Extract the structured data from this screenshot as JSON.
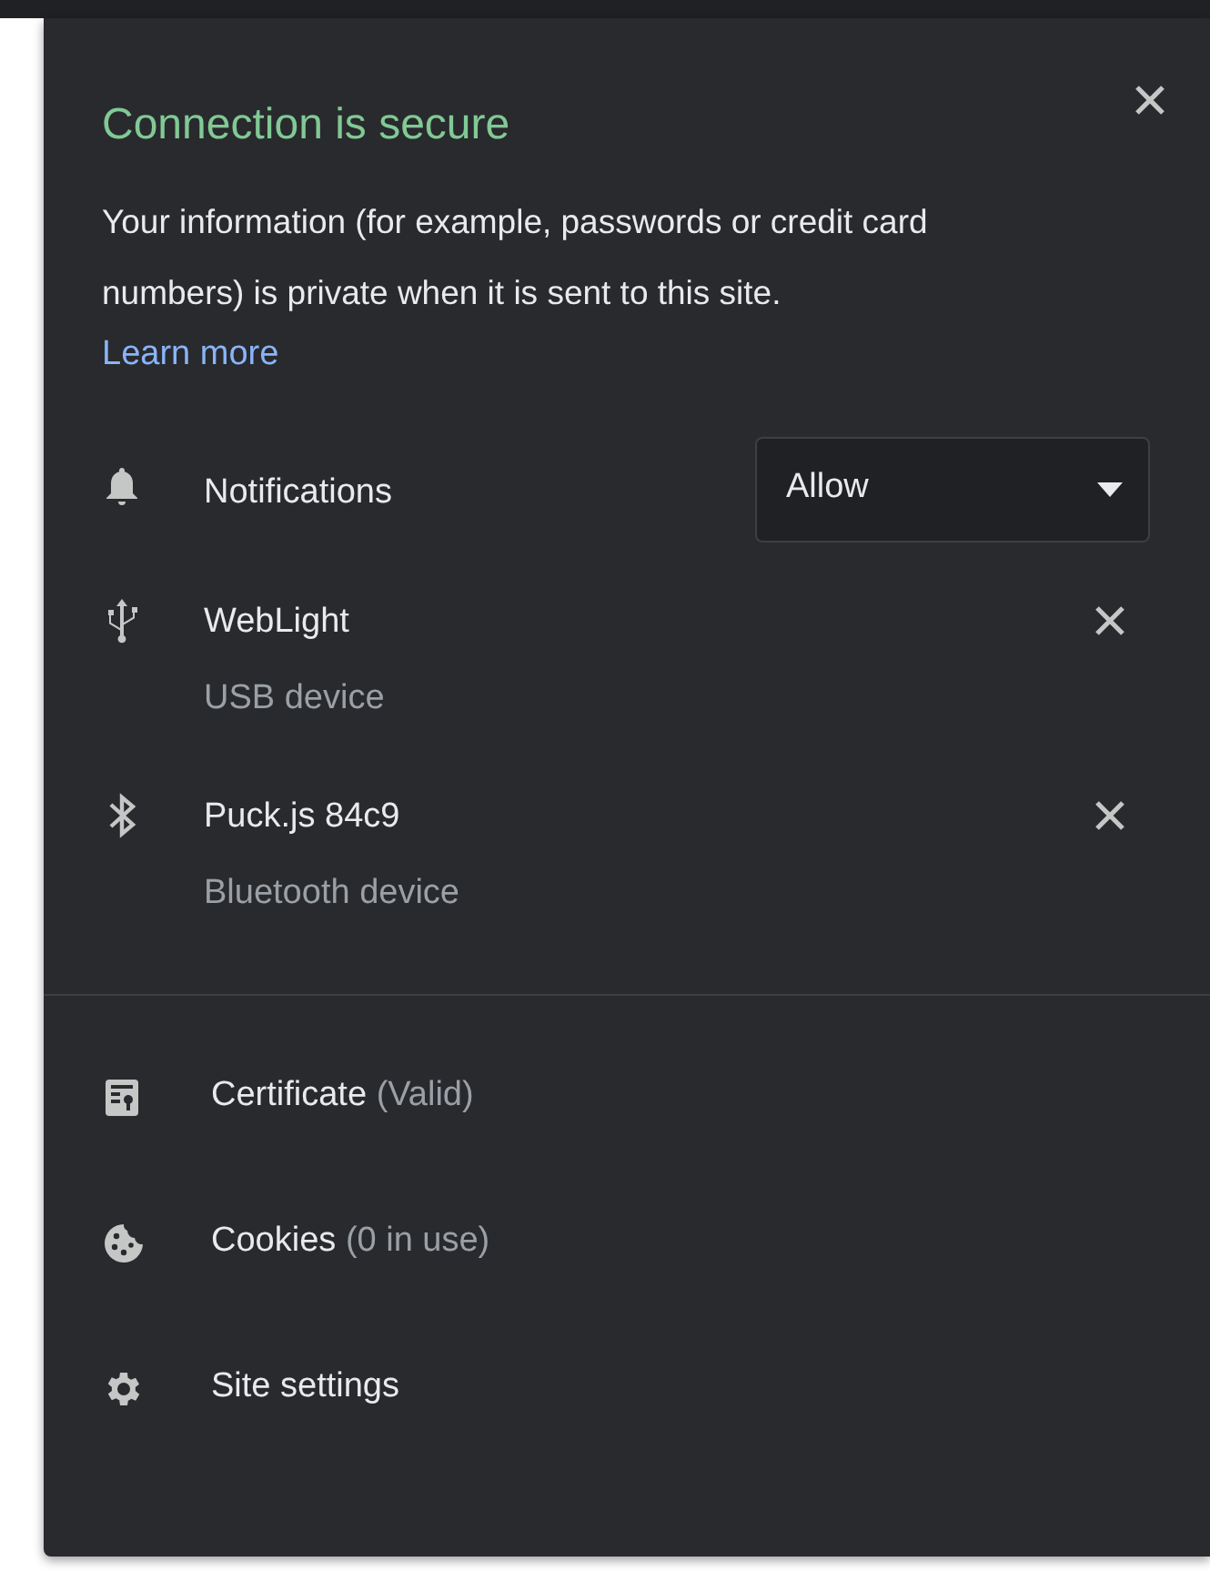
{
  "title": "Connection is secure",
  "description": "Your information (for example, passwords or credit card numbers) is private when it is sent to this site.",
  "learn_more": "Learn more",
  "permissions": [
    {
      "kind": "notifications",
      "label": "Notifications",
      "value": "Allow"
    },
    {
      "kind": "usb",
      "label": "WebLight",
      "sublabel": "USB device"
    },
    {
      "kind": "bluetooth",
      "label": "Puck.js 84c9",
      "sublabel": "Bluetooth device"
    }
  ],
  "links": [
    {
      "kind": "certificate",
      "label": "Certificate",
      "detail": "(Valid)"
    },
    {
      "kind": "cookies",
      "label": "Cookies",
      "detail": "(0 in use)"
    },
    {
      "kind": "settings",
      "label": "Site settings"
    }
  ]
}
